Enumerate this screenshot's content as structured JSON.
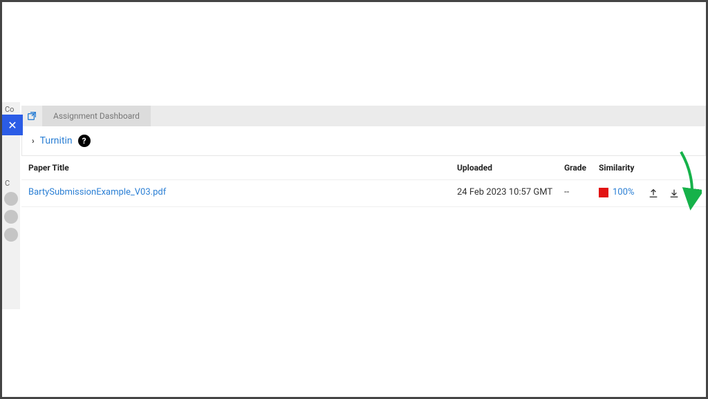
{
  "left_strip": {
    "label_1": "Co",
    "label_2": "C"
  },
  "close_button": {
    "symbol": "✕"
  },
  "toolbar": {
    "tab_label": "Assignment Dashboard"
  },
  "breadcrumb": {
    "link_text": "Turnitin",
    "help_symbol": "?"
  },
  "table": {
    "headers": {
      "title": "Paper Title",
      "uploaded": "Uploaded",
      "grade": "Grade",
      "similarity": "Similarity"
    },
    "rows": [
      {
        "title": "BartySubmissionExample_V03.pdf",
        "uploaded": "24 Feb 2023 10:57 GMT",
        "grade": "--",
        "similarity_pct": "100%",
        "similarity_color": "#e21313"
      }
    ]
  },
  "icons": {
    "upload": "upload-icon",
    "download": "download-icon",
    "list": "list-icon"
  }
}
